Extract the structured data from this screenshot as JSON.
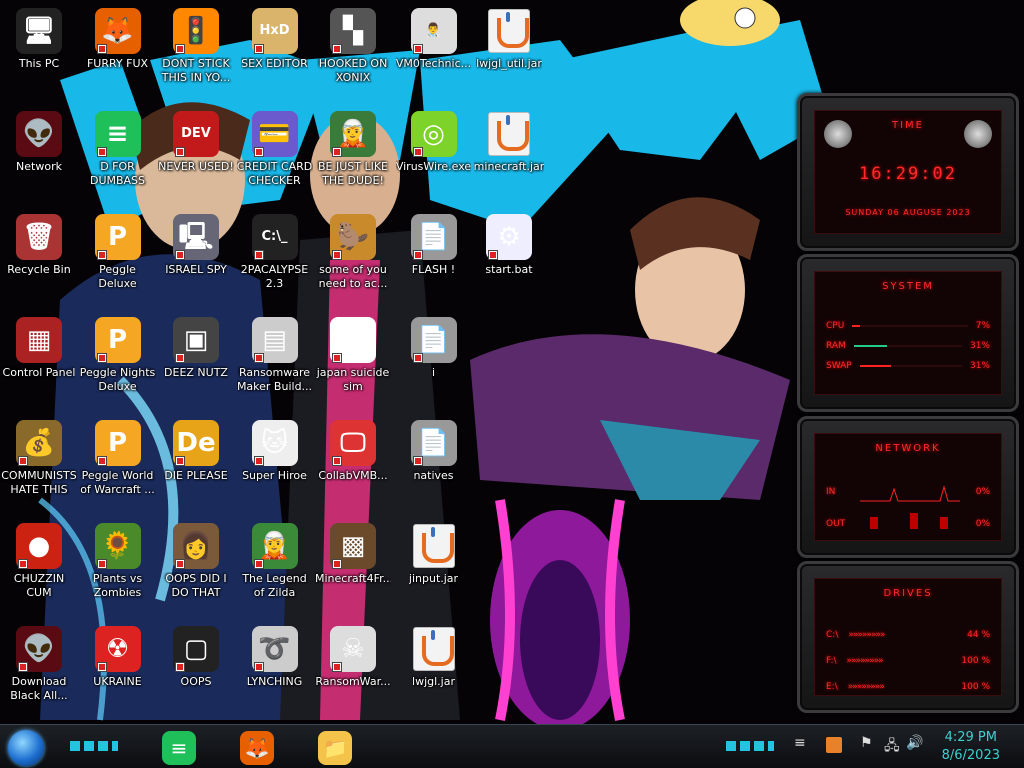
{
  "desktop_icons": [
    {
      "label": "This PC",
      "icon": "computer-icon",
      "glyph": "🖥",
      "bg": "#222"
    },
    {
      "label": "FURRY FUX",
      "icon": "firefox-icon",
      "glyph": "🦊",
      "bg": "#e66000"
    },
    {
      "label": "DONT STICK THIS IN YO...",
      "icon": "vlc-cone-icon",
      "glyph": "🚦",
      "bg": "#ff8800"
    },
    {
      "label": "SEX EDITOR",
      "icon": "hex-editor-icon",
      "glyph": "HxD",
      "bg": "#d9b46a"
    },
    {
      "label": "HOOKED ON XONIX",
      "icon": "xonix-game-icon",
      "glyph": "▚",
      "bg": "#555"
    },
    {
      "label": "VM0Technic...",
      "icon": "doctor-icon",
      "glyph": "👨‍⚕️",
      "bg": "#ddd"
    },
    {
      "label": "lwjgl_util.jar",
      "icon": "java-jar-icon",
      "glyph": "",
      "bg": ""
    },
    {
      "label": "Network",
      "icon": "network-alien-icon",
      "glyph": "👽",
      "bg": "#5a0a12"
    },
    {
      "label": "D FOR DUMBASS",
      "icon": "green-document-icon",
      "glyph": "≡",
      "bg": "#1fbf5a"
    },
    {
      "label": "NEVER USED!",
      "icon": "dev-cpp-icon",
      "glyph": "DEV",
      "bg": "#c21a1a"
    },
    {
      "label": "CREDIT CARD CHECKER",
      "icon": "credit-card-icon",
      "glyph": "💳",
      "bg": "#6a5acd"
    },
    {
      "label": "BE JUST LIKE THE DUDE!",
      "icon": "elf-icon",
      "glyph": "🧝",
      "bg": "#3a7a3a"
    },
    {
      "label": "VirusWire.exe",
      "icon": "lime-icon",
      "glyph": "◎",
      "bg": "#7dd32a"
    },
    {
      "label": "minecraft.jar",
      "icon": "java-jar-icon",
      "glyph": "",
      "bg": ""
    },
    {
      "label": "Recycle Bin",
      "icon": "recycle-bin-icon",
      "glyph": "🗑",
      "bg": "#a33"
    },
    {
      "label": "Peggle Deluxe",
      "icon": "peggle-icon",
      "glyph": "P",
      "bg": "#f5a623"
    },
    {
      "label": "ISRAEL SPY",
      "icon": "spy-monitor-icon",
      "glyph": "🖳",
      "bg": "#667"
    },
    {
      "label": "2PACALYPSE 2.3",
      "icon": "terminal-icon",
      "glyph": "C:\\_",
      "bg": "#222"
    },
    {
      "label": "some of you need to ac...",
      "icon": "beaver-icon",
      "glyph": "🦫",
      "bg": "#c88a2a"
    },
    {
      "label": "FLASH !",
      "icon": "flash-document-icon",
      "glyph": "📄",
      "bg": "#999"
    },
    {
      "label": "start.bat",
      "icon": "gear-batch-icon",
      "glyph": "⚙",
      "bg": "#eef"
    },
    {
      "label": "Control Panel",
      "icon": "control-panel-icon",
      "glyph": "▦",
      "bg": "#a22"
    },
    {
      "label": "Peggle Nights Deluxe",
      "icon": "peggle-nights-icon",
      "glyph": "P",
      "bg": "#f5a623"
    },
    {
      "label": "DEEZ NUTZ",
      "icon": "window-stack-icon",
      "glyph": "▣",
      "bg": "#444"
    },
    {
      "label": "Ransomware Maker Build...",
      "icon": "app-window-icon",
      "glyph": "▤",
      "bg": "#ccc"
    },
    {
      "label": "japan suicide sim",
      "icon": "game-file-icon",
      "glyph": "▮",
      "bg": "#fff"
    },
    {
      "label": "i",
      "icon": "document-icon",
      "glyph": "📄",
      "bg": "#999"
    },
    {
      "label": "",
      "icon": "",
      "glyph": "",
      "bg": ""
    },
    {
      "label": "COMMUNISTS HATE THIS G...",
      "icon": "money-bag-icon",
      "glyph": "💰",
      "bg": "#8a6a2a"
    },
    {
      "label": "Peggle World of Warcraft ...",
      "icon": "peggle-wow-icon",
      "glyph": "P",
      "bg": "#f5a623"
    },
    {
      "label": "DIE PLEASE",
      "icon": "de-icon",
      "glyph": "De",
      "bg": "#e8a418"
    },
    {
      "label": "Super Hiroe",
      "icon": "pixel-cat-icon",
      "glyph": "🐱",
      "bg": "#eee"
    },
    {
      "label": "CollabVMB...",
      "icon": "monitor-pink-icon",
      "glyph": "🖵",
      "bg": "#d33"
    },
    {
      "label": "natives",
      "icon": "document-icon",
      "glyph": "📄",
      "bg": "#999"
    },
    {
      "label": "",
      "icon": "",
      "glyph": "",
      "bg": ""
    },
    {
      "label": "CHUZZIN CUM",
      "icon": "chuzzle-icon",
      "glyph": "●",
      "bg": "#c21"
    },
    {
      "label": "Plants vs Zombies",
      "icon": "plants-vs-zombies-icon",
      "glyph": "🌻",
      "bg": "#4a8a2a"
    },
    {
      "label": "OOPS DID I DO THAT",
      "icon": "portrait-icon",
      "glyph": "👩",
      "bg": "#7a5a3a"
    },
    {
      "label": "The Legend of Zilda",
      "icon": "zelda-sprite-icon",
      "glyph": "🧝",
      "bg": "#3a8a3a"
    },
    {
      "label": "Minecraft4Fr...",
      "icon": "minecraft-block-icon",
      "glyph": "▩",
      "bg": "#6a4a2a"
    },
    {
      "label": "jinput.jar",
      "icon": "java-jar-icon",
      "glyph": "",
      "bg": ""
    },
    {
      "label": "",
      "icon": "",
      "glyph": "",
      "bg": ""
    },
    {
      "label": "Download Black All...",
      "icon": "alien-orb-icon",
      "glyph": "👽",
      "bg": "#5a0a12"
    },
    {
      "label": "UKRAINE",
      "icon": "radiation-icon",
      "glyph": "☢",
      "bg": "#d22"
    },
    {
      "label": "OOPS",
      "icon": "dark-monitor-icon",
      "glyph": "▢",
      "bg": "#222"
    },
    {
      "label": "LYNCHING",
      "icon": "noose-icon",
      "glyph": "➰",
      "bg": "#ccc"
    },
    {
      "label": "RansomWar...",
      "icon": "skull-icon",
      "glyph": "☠",
      "bg": "#ddd"
    },
    {
      "label": "lwjgl.jar",
      "icon": "java-jar-icon",
      "glyph": "",
      "bg": ""
    },
    {
      "label": "",
      "icon": "",
      "glyph": "",
      "bg": ""
    }
  ],
  "gadget_time": {
    "title": "TIME",
    "time": "16:29:02",
    "date": "SUNDAY 06 AUGUSE 2023"
  },
  "gadget_system": {
    "title": "SYSTEM",
    "rows": [
      {
        "label": "CPU",
        "value": "7%",
        "fill": 0.07
      },
      {
        "label": "RAM",
        "value": "31%",
        "fill": 0.31
      },
      {
        "label": "SWAP",
        "value": "31%",
        "fill": 0.31
      }
    ]
  },
  "gadget_network": {
    "title": "NETWORK",
    "in_label": "IN",
    "in_value": "0%",
    "out_label": "OUT",
    "out_value": "0%"
  },
  "gadget_drives": {
    "title": "DRIVES",
    "rows": [
      {
        "label": "C:\\",
        "value": "44 %"
      },
      {
        "label": "F:\\",
        "value": "100 %"
      },
      {
        "label": "E:\\",
        "value": "100 %"
      }
    ]
  },
  "taskbar": {
    "pinned": [
      {
        "name": "green-app-taskbar-icon",
        "glyph": "≡",
        "color": "#1fbf5a"
      },
      {
        "name": "firefox-taskbar-icon",
        "glyph": "🦊",
        "color": "#e66000"
      },
      {
        "name": "file-explorer-taskbar-icon",
        "glyph": "📁",
        "color": "#f3c34a"
      }
    ]
  },
  "clock": {
    "time": "4:29 PM",
    "date": "8/6/2023"
  },
  "colors": {
    "accent_red": "#ff2a2a",
    "clock_teal": "#3ecfcf",
    "wallpaper_cyan": "#18b8e8",
    "wallpaper_pink": "#e0308a"
  }
}
